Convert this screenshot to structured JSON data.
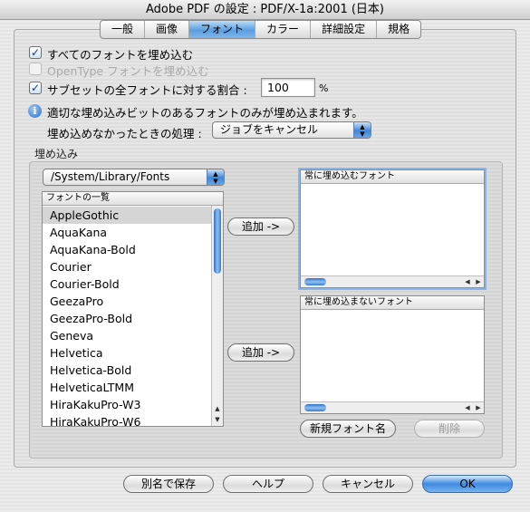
{
  "window": {
    "title": "Adobe PDF の設定 : PDF/X-1a:2001 (日本)"
  },
  "tabs": [
    {
      "label": "一般",
      "active": false
    },
    {
      "label": "画像",
      "active": false
    },
    {
      "label": "フォント",
      "active": true
    },
    {
      "label": "カラー",
      "active": false
    },
    {
      "label": "詳細設定",
      "active": false
    },
    {
      "label": "規格",
      "active": false
    }
  ],
  "options": {
    "embed_all": {
      "label": "すべてのフォントを埋め込む",
      "checked": true
    },
    "embed_opentype": {
      "label": "OpenType フォントを埋め込む",
      "checked": false,
      "disabled": true
    },
    "subset": {
      "label": "サブセットの全フォントに対する割合 :",
      "checked": true,
      "value": "100",
      "unit": "%"
    }
  },
  "info": {
    "icon": "info-icon",
    "message": "適切な埋め込みビットのあるフォントのみが埋め込まれます。"
  },
  "failure": {
    "label": "埋め込めなかったときの処理 :",
    "value": "ジョブをキャンセル"
  },
  "embed_group": {
    "label": "埋め込み",
    "folder_popup": "/System/Library/Fonts",
    "font_list_header": "フォントの一覧",
    "font_list": [
      "AppleGothic",
      "AquaKana",
      "AquaKana-Bold",
      "Courier",
      "Courier-Bold",
      "GeezaPro",
      "GeezaPro-Bold",
      "Geneva",
      "Helvetica",
      "Helvetica-Bold",
      "HelveticaLTMM",
      "HiraKakuPro-W3",
      "HiraKakuPro-W6"
    ],
    "selected_font": "AppleGothic",
    "add_always_button": "追加 ->",
    "add_never_button": "追加 ->",
    "always_embed_header": "常に埋め込むフォント",
    "never_embed_header": "常に埋め込まないフォント",
    "new_font_button": "新規フォント名",
    "delete_button": "削除"
  },
  "footer": {
    "save_as": "別名で保存",
    "help": "ヘルプ",
    "cancel": "キャンセル",
    "ok": "OK"
  }
}
